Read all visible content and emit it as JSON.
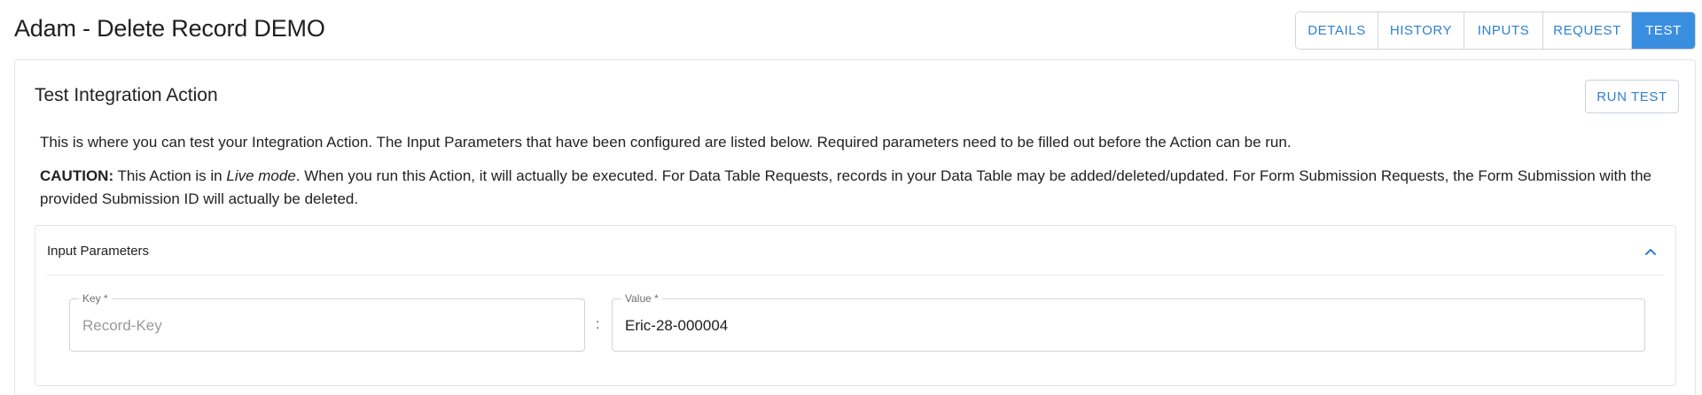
{
  "header": {
    "title": "Adam - Delete Record DEMO"
  },
  "tabs": [
    {
      "label": "DETAILS",
      "active": false
    },
    {
      "label": "HISTORY",
      "active": false
    },
    {
      "label": "INPUTS",
      "active": false
    },
    {
      "label": "REQUEST",
      "active": false
    },
    {
      "label": "TEST",
      "active": true
    }
  ],
  "test_panel": {
    "title": "Test Integration Action",
    "run_button_label": "RUN TEST",
    "description": "This is where you can test your Integration Action. The Input Parameters that have been configured are listed below. Required parameters need to be filled out before the Action can be run.",
    "caution": {
      "label": "CAUTION:",
      "text_before": " This Action is in ",
      "mode": "Live mode",
      "text_after": ". When you run this Action, it will actually be executed. For Data Table Requests, records in your Data Table may be added/deleted/updated. For Form Submission Requests, the Form Submission with the provided Submission ID will actually be deleted."
    }
  },
  "input_parameters": {
    "title": "Input Parameters",
    "separator": ":",
    "rows": [
      {
        "key_label": "Key *",
        "key_placeholder": "Record-Key",
        "value_label": "Value *",
        "value": "Eric-28-000004"
      }
    ]
  },
  "colors": {
    "accent": "#3a8ee0",
    "link": "#2f80d1",
    "border": "#d0d5da"
  },
  "icons": {
    "collapse": "chevron-up-icon"
  }
}
